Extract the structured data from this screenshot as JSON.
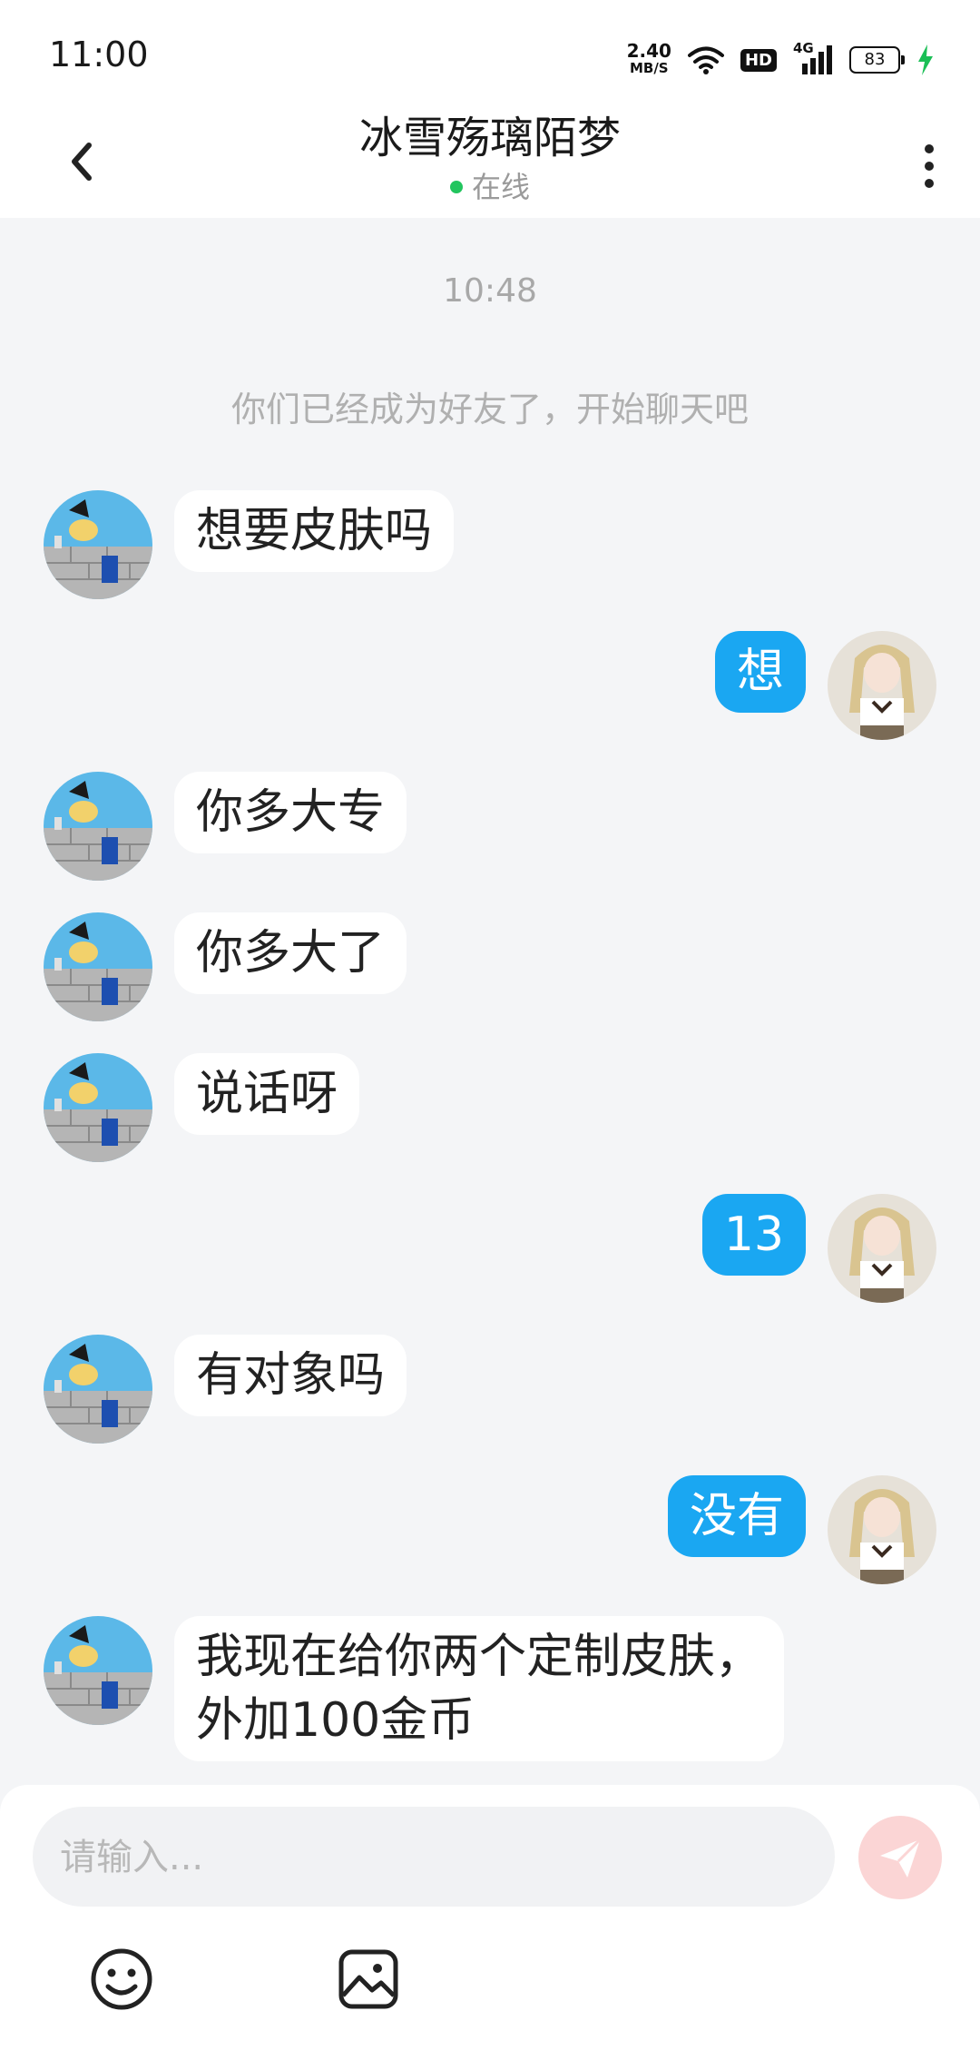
{
  "status_bar": {
    "time": "11:00",
    "speed_value": "2.40",
    "speed_unit": "MB/S",
    "hd_label": "HD",
    "network_label": "4G",
    "battery": "83"
  },
  "header": {
    "title": "冰雪殇璃陌梦",
    "status": "在线",
    "back_icon": "chevron-left-icon",
    "more_icon": "more-vertical-icon"
  },
  "chat": {
    "timestamp": "10:48",
    "system_message": "你们已经成为好友了，开始聊天吧",
    "messages": [
      {
        "from": "them",
        "text": "想要皮肤吗"
      },
      {
        "from": "me",
        "text": "想"
      },
      {
        "from": "them",
        "text": "你多大专"
      },
      {
        "from": "them",
        "text": "你多大了"
      },
      {
        "from": "them",
        "text": "说话呀"
      },
      {
        "from": "me",
        "text": "13"
      },
      {
        "from": "them",
        "text": "有对象吗"
      },
      {
        "from": "me",
        "text": "没有"
      },
      {
        "from": "them",
        "text": "我现在给你两个定制皮肤，\n外加100金币"
      }
    ]
  },
  "composer": {
    "placeholder": "请输入...",
    "send_icon": "send-icon",
    "emoji_icon": "emoji-icon",
    "image_icon": "image-icon"
  },
  "colors": {
    "accent": "#1aa7f2",
    "online": "#22c55e",
    "send_disabled": "#fbd5d5",
    "background": "#f4f5f7"
  }
}
